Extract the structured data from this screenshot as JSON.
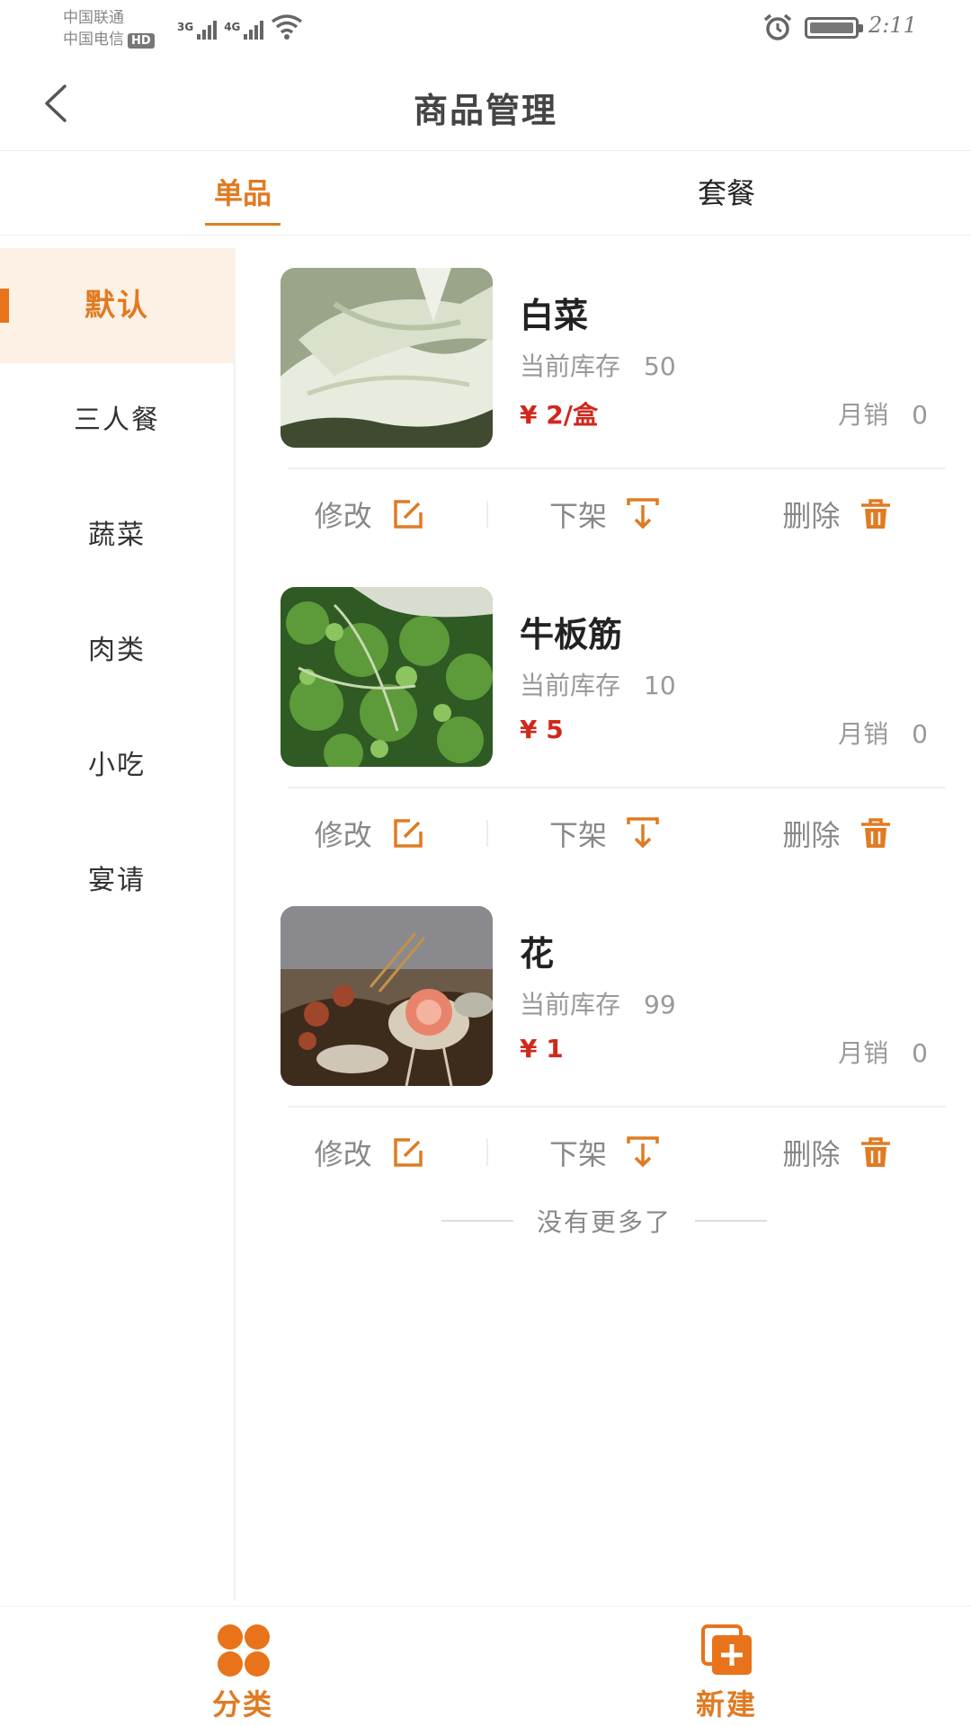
{
  "status_bar": {
    "carrier1": "中国联通",
    "carrier2": "中国电信",
    "hd": "HD",
    "net1": "3G",
    "net2": "4G",
    "time": "2:11"
  },
  "header": {
    "title": "商品管理"
  },
  "tabs": [
    {
      "label": "单品"
    },
    {
      "label": "套餐"
    }
  ],
  "sidebar": {
    "items": [
      {
        "label": "默认"
      },
      {
        "label": "三人餐"
      },
      {
        "label": "蔬菜"
      },
      {
        "label": "肉类"
      },
      {
        "label": "小吃"
      },
      {
        "label": "宴请"
      }
    ]
  },
  "products": [
    {
      "name": "白菜",
      "stock_label": "当前库存",
      "stock": "50",
      "price": "¥ 2/盒",
      "sales_label": "月销",
      "sales": "0"
    },
    {
      "name": "牛板筋",
      "stock_label": "当前库存",
      "stock": "10",
      "price": "¥ 5",
      "sales_label": "月销",
      "sales": "0"
    },
    {
      "name": "花",
      "stock_label": "当前库存",
      "stock": "99",
      "price": "¥ 1",
      "sales_label": "月销",
      "sales": "0"
    }
  ],
  "actions": {
    "edit": "修改",
    "offshelf": "下架",
    "delete": "删除"
  },
  "list_footer": "没有更多了",
  "bottom_bar": {
    "category": "分类",
    "create": "新建"
  },
  "colors": {
    "accent": "#e07b22",
    "price": "#d0281c",
    "active_bg": "#fdf1e6"
  },
  "icons": [
    "back-icon",
    "edit-icon",
    "download-icon",
    "trash-icon",
    "grid-icon",
    "add-icon"
  ]
}
